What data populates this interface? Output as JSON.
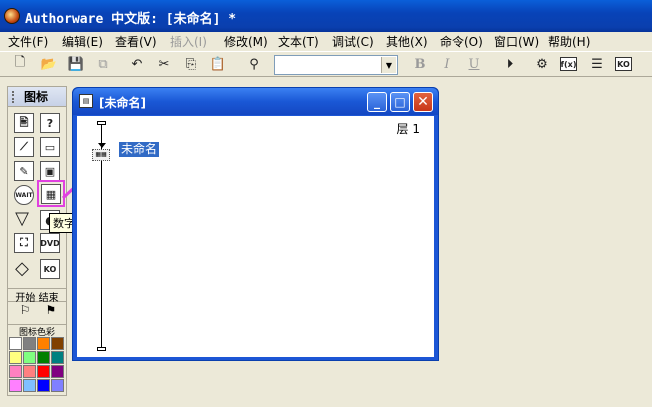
{
  "app": {
    "title": "Authorware 中文版: [未命名] *"
  },
  "menu": [
    {
      "label": "文件(F)",
      "enabled": true
    },
    {
      "label": "编辑(E)",
      "enabled": true
    },
    {
      "label": "查看(V)",
      "enabled": true
    },
    {
      "label": "插入(I)",
      "enabled": false
    },
    {
      "label": "修改(M)",
      "enabled": true
    },
    {
      "label": "文本(T)",
      "enabled": true
    },
    {
      "label": "调试(C)",
      "enabled": true
    },
    {
      "label": "其他(X)",
      "enabled": true
    },
    {
      "label": "命令(O)",
      "enabled": true
    },
    {
      "label": "窗口(W)",
      "enabled": true
    },
    {
      "label": "帮助(H)",
      "enabled": true
    }
  ],
  "toolbar": {
    "font_select_value": "",
    "bold": "B",
    "italic": "I",
    "underline": "U",
    "functions_label": "f(x)",
    "knowledge_label": "KO"
  },
  "palette": {
    "title": "图标",
    "start_label": "开始",
    "end_label": "结束",
    "colors_label": "图标色彩",
    "wait_label": "WAIT",
    "dvd_label": "DVD",
    "ko_label": "KO",
    "tooltip": "数字电影",
    "colors": [
      "#ffffff",
      "#808080",
      "#ff8000",
      "#804000",
      "#ffff80",
      "#80ff80",
      "#008000",
      "#008080",
      "#ff80c0",
      "#ff8080",
      "#ff0000",
      "#800080",
      "#ff80ff",
      "#80c0ff",
      "#0000ff",
      "#8080ff"
    ]
  },
  "design_window": {
    "title": "[未命名]",
    "layer_label": "层 1",
    "selected_icon_name": "未命名"
  }
}
